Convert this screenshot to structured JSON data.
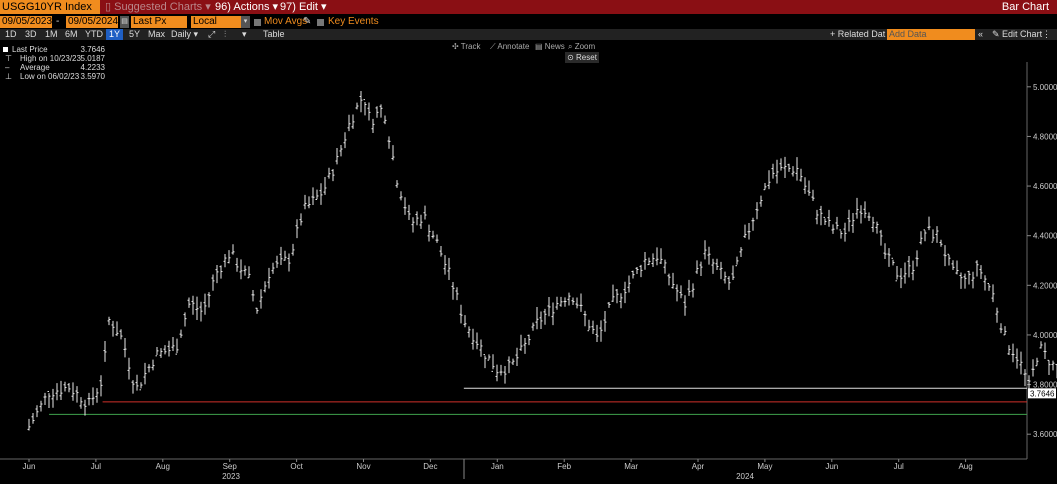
{
  "header": {
    "ticker": "USGG10YR Index",
    "suggested": "Suggested Charts",
    "actions": "Actions",
    "edit": "Edit",
    "title": "Bar Chart",
    "actions_prefix": "96",
    "edit_prefix": "97"
  },
  "controls": {
    "start_date": "09/05/2023",
    "end_date": "09/05/2024",
    "field": "Last Px",
    "currency": "Local CCY",
    "mov_avgs": "Mov Avgs",
    "key_events": "Key Events",
    "periods": [
      "1D",
      "3D",
      "1M",
      "6M",
      "YTD",
      "1Y",
      "5Y",
      "Max"
    ],
    "selected_period": "1Y",
    "frequency": "Daily",
    "table": "Table",
    "related_data": "+ Related Dat",
    "add_data_placeholder": "Add Data",
    "edit_chart": "Edit Chart"
  },
  "tools": {
    "track": "Track",
    "annotate": "Annotate",
    "news": "News",
    "zoom": "Zoom",
    "reset": "Reset"
  },
  "legend": [
    {
      "label": "Last Price",
      "value": "3.7646"
    },
    {
      "label": "High on 10/23/23",
      "value": "5.0187"
    },
    {
      "label": "Average",
      "value": "4.2233"
    },
    {
      "label": "Low on 06/02/23",
      "value": "3.5970"
    }
  ],
  "colors": {
    "accent": "#f08c1e",
    "header_bg": "#8a0f14",
    "price": "#e8e8e8",
    "red_line": "#d0302a",
    "green_line": "#3fa34d"
  },
  "chart_data": {
    "type": "bar",
    "subtype": "ohlc-price-bars",
    "series_name": "USGG10YR Index",
    "ylim": [
      3.5,
      5.1
    ],
    "y_ticks": [
      "3.6000",
      "3.8000",
      "4.0000",
      "4.2000",
      "4.4000",
      "4.6000",
      "4.8000",
      "5.0000"
    ],
    "x_month_labels": [
      "Jun",
      "Jul",
      "Aug",
      "Sep",
      "Oct",
      "Nov",
      "Dec",
      "Jan",
      "Feb",
      "Mar",
      "Apr",
      "May",
      "Jun",
      "Jul",
      "Aug"
    ],
    "x_year_labels": [
      "2023",
      "2024"
    ],
    "last_value_label": "3.7646",
    "horizontal_lines": [
      {
        "name": "white",
        "value": 3.785,
        "from_month_index": 6.5
      },
      {
        "name": "red",
        "value": 3.73,
        "from_month_index": 1.1
      },
      {
        "name": "green",
        "value": 3.68,
        "from_month_index": 0.3
      }
    ],
    "path_points": [
      [
        0.0,
        3.63
      ],
      [
        0.3,
        3.77
      ],
      [
        0.6,
        3.79
      ],
      [
        0.9,
        3.72
      ],
      [
        1.1,
        3.82
      ],
      [
        1.2,
        4.07
      ],
      [
        1.4,
        3.98
      ],
      [
        1.6,
        3.78
      ],
      [
        1.9,
        3.92
      ],
      [
        2.2,
        3.95
      ],
      [
        2.4,
        4.13
      ],
      [
        2.6,
        4.09
      ],
      [
        2.8,
        4.25
      ],
      [
        3.0,
        4.33
      ],
      [
        3.3,
        4.22
      ],
      [
        3.4,
        4.1
      ],
      [
        3.6,
        4.26
      ],
      [
        3.9,
        4.31
      ],
      [
        4.1,
        4.5
      ],
      [
        4.4,
        4.58
      ],
      [
        4.6,
        4.7
      ],
      [
        4.8,
        4.86
      ],
      [
        5.0,
        4.97
      ],
      [
        5.1,
        4.86
      ],
      [
        5.3,
        4.92
      ],
      [
        5.5,
        4.63
      ],
      [
        5.7,
        4.45
      ],
      [
        5.9,
        4.48
      ],
      [
        6.1,
        4.37
      ],
      [
        6.3,
        4.23
      ],
      [
        6.5,
        4.06
      ],
      [
        6.8,
        3.93
      ],
      [
        7.0,
        3.86
      ],
      [
        7.2,
        3.87
      ],
      [
        7.4,
        3.95
      ],
      [
        7.6,
        4.05
      ],
      [
        7.9,
        4.13
      ],
      [
        8.1,
        4.17
      ],
      [
        8.3,
        4.08
      ],
      [
        8.5,
        3.98
      ],
      [
        8.7,
        4.12
      ],
      [
        9.0,
        4.22
      ],
      [
        9.2,
        4.3
      ],
      [
        9.4,
        4.32
      ],
      [
        9.6,
        4.22
      ],
      [
        9.8,
        4.12
      ],
      [
        10.1,
        4.33
      ],
      [
        10.3,
        4.26
      ],
      [
        10.5,
        4.2
      ],
      [
        10.7,
        4.38
      ],
      [
        10.9,
        4.53
      ],
      [
        11.1,
        4.65
      ],
      [
        11.3,
        4.67
      ],
      [
        11.5,
        4.67
      ],
      [
        11.6,
        4.6
      ],
      [
        11.8,
        4.49
      ],
      [
        12.0,
        4.43
      ],
      [
        12.2,
        4.41
      ],
      [
        12.4,
        4.52
      ],
      [
        12.6,
        4.49
      ],
      [
        12.8,
        4.32
      ],
      [
        13.0,
        4.24
      ],
      [
        13.2,
        4.27
      ],
      [
        13.4,
        4.42
      ],
      [
        13.6,
        4.4
      ],
      [
        13.8,
        4.25
      ],
      [
        14.0,
        4.22
      ],
      [
        14.2,
        4.27
      ],
      [
        14.4,
        4.17
      ],
      [
        14.6,
        3.98
      ],
      [
        14.8,
        3.9
      ],
      [
        14.95,
        3.79
      ],
      [
        15.1,
        3.95
      ],
      [
        15.3,
        3.88
      ],
      [
        15.5,
        3.82
      ],
      [
        15.7,
        3.85
      ],
      [
        15.9,
        3.8
      ],
      [
        16.1,
        3.82
      ],
      [
        16.3,
        3.88
      ],
      [
        16.45,
        3.77
      ]
    ]
  }
}
